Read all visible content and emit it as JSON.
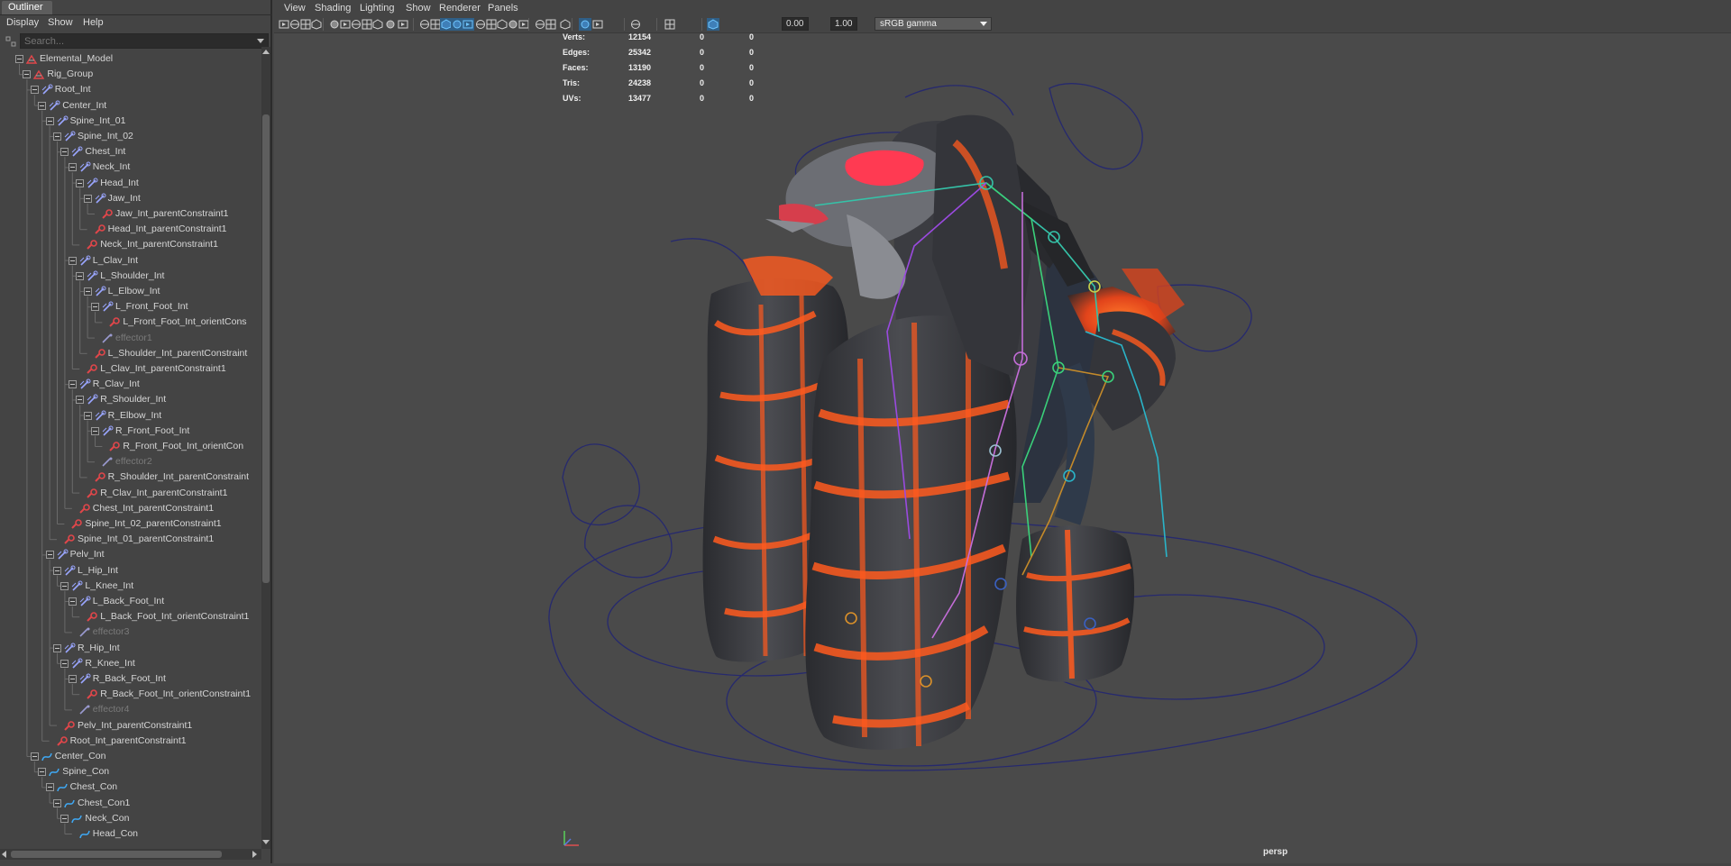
{
  "outliner": {
    "tab_label": "Outliner",
    "menus": [
      "Display",
      "Show",
      "Help"
    ],
    "search_placeholder": "Search...",
    "tree": [
      {
        "label": "Elemental_Model",
        "depth": 0,
        "type": "mesh"
      },
      {
        "label": "Rig_Group",
        "depth": 1,
        "type": "mesh"
      },
      {
        "label": "Root_Int",
        "depth": 2,
        "type": "joint"
      },
      {
        "label": "Center_Int",
        "depth": 3,
        "type": "joint"
      },
      {
        "label": "Spine_Int_01",
        "depth": 4,
        "type": "joint"
      },
      {
        "label": "Spine_Int_02",
        "depth": 5,
        "type": "joint"
      },
      {
        "label": "Chest_Int",
        "depth": 6,
        "type": "joint"
      },
      {
        "label": "Neck_Int",
        "depth": 7,
        "type": "joint"
      },
      {
        "label": "Head_Int",
        "depth": 8,
        "type": "joint"
      },
      {
        "label": "Jaw_Int",
        "depth": 9,
        "type": "joint"
      },
      {
        "label": "Jaw_Int_parentConstraint1",
        "depth": 10,
        "type": "constraint"
      },
      {
        "label": "Head_Int_parentConstraint1",
        "depth": 9,
        "type": "constraint"
      },
      {
        "label": "Neck_Int_parentConstraint1",
        "depth": 8,
        "type": "constraint"
      },
      {
        "label": "L_Clav_Int",
        "depth": 7,
        "type": "joint"
      },
      {
        "label": "L_Shoulder_Int",
        "depth": 8,
        "type": "joint"
      },
      {
        "label": "L_Elbow_Int",
        "depth": 9,
        "type": "joint"
      },
      {
        "label": "L_Front_Foot_Int",
        "depth": 10,
        "type": "joint"
      },
      {
        "label": "L_Front_Foot_Int_orientCons",
        "depth": 11,
        "type": "constraint"
      },
      {
        "label": "effector1",
        "depth": 10,
        "type": "effector"
      },
      {
        "label": "L_Shoulder_Int_parentConstraint",
        "depth": 9,
        "type": "constraint"
      },
      {
        "label": "L_Clav_Int_parentConstraint1",
        "depth": 8,
        "type": "constraint"
      },
      {
        "label": "R_Clav_Int",
        "depth": 7,
        "type": "joint"
      },
      {
        "label": "R_Shoulder_Int",
        "depth": 8,
        "type": "joint"
      },
      {
        "label": "R_Elbow_Int",
        "depth": 9,
        "type": "joint"
      },
      {
        "label": "R_Front_Foot_Int",
        "depth": 10,
        "type": "joint"
      },
      {
        "label": "R_Front_Foot_Int_orientCon",
        "depth": 11,
        "type": "constraint"
      },
      {
        "label": "effector2",
        "depth": 10,
        "type": "effector"
      },
      {
        "label": "R_Shoulder_Int_parentConstraint",
        "depth": 9,
        "type": "constraint"
      },
      {
        "label": "R_Clav_Int_parentConstraint1",
        "depth": 8,
        "type": "constraint"
      },
      {
        "label": "Chest_Int_parentConstraint1",
        "depth": 7,
        "type": "constraint"
      },
      {
        "label": "Spine_Int_02_parentConstraint1",
        "depth": 6,
        "type": "constraint"
      },
      {
        "label": "Spine_Int_01_parentConstraint1",
        "depth": 5,
        "type": "constraint"
      },
      {
        "label": "Pelv_Int",
        "depth": 4,
        "type": "joint"
      },
      {
        "label": "L_Hip_Int",
        "depth": 5,
        "type": "joint"
      },
      {
        "label": "L_Knee_Int",
        "depth": 6,
        "type": "joint"
      },
      {
        "label": "L_Back_Foot_Int",
        "depth": 7,
        "type": "joint"
      },
      {
        "label": "L_Back_Foot_Int_orientConstraint1",
        "depth": 8,
        "type": "constraint"
      },
      {
        "label": "effector3",
        "depth": 7,
        "type": "effector"
      },
      {
        "label": "R_Hip_Int",
        "depth": 5,
        "type": "joint"
      },
      {
        "label": "R_Knee_Int",
        "depth": 6,
        "type": "joint"
      },
      {
        "label": "R_Back_Foot_Int",
        "depth": 7,
        "type": "joint"
      },
      {
        "label": "R_Back_Foot_Int_orientConstraint1",
        "depth": 8,
        "type": "constraint"
      },
      {
        "label": "effector4",
        "depth": 7,
        "type": "effector"
      },
      {
        "label": "Pelv_Int_parentConstraint1",
        "depth": 5,
        "type": "constraint"
      },
      {
        "label": "Root_Int_parentConstraint1",
        "depth": 4,
        "type": "constraint"
      },
      {
        "label": "Center_Con",
        "depth": 2,
        "type": "curve"
      },
      {
        "label": "Spine_Con",
        "depth": 3,
        "type": "curve"
      },
      {
        "label": "Chest_Con",
        "depth": 4,
        "type": "curve"
      },
      {
        "label": "Chest_Con1",
        "depth": 5,
        "type": "curve"
      },
      {
        "label": "Neck_Con",
        "depth": 6,
        "type": "curve"
      },
      {
        "label": "Head_Con",
        "depth": 7,
        "type": "curve"
      }
    ]
  },
  "viewport": {
    "menus": [
      "View",
      "Shading",
      "Lighting",
      "Show",
      "Renderer",
      "Panels"
    ],
    "exposure_value": "0.00",
    "gamma_value": "1.00",
    "color_space": "sRGB gamma",
    "camera_label": "persp",
    "hud": [
      {
        "label": "Verts:",
        "value": "12154",
        "a": "0",
        "b": "0"
      },
      {
        "label": "Edges:",
        "value": "25342",
        "a": "0",
        "b": "0"
      },
      {
        "label": "Faces:",
        "value": "13190",
        "a": "0",
        "b": "0"
      },
      {
        "label": "Tris:",
        "value": "24238",
        "a": "0",
        "b": "0"
      },
      {
        "label": "UVs:",
        "value": "13477",
        "a": "0",
        "b": "0"
      }
    ]
  },
  "colors": {
    "joint_icon": "#9aa6ff",
    "constraint_icon": "#e0464a",
    "curve_icon": "#3fa9f5",
    "lava": "#ff5a1e",
    "rock": "#2f3033",
    "control_curve": "#2b2e7a"
  }
}
